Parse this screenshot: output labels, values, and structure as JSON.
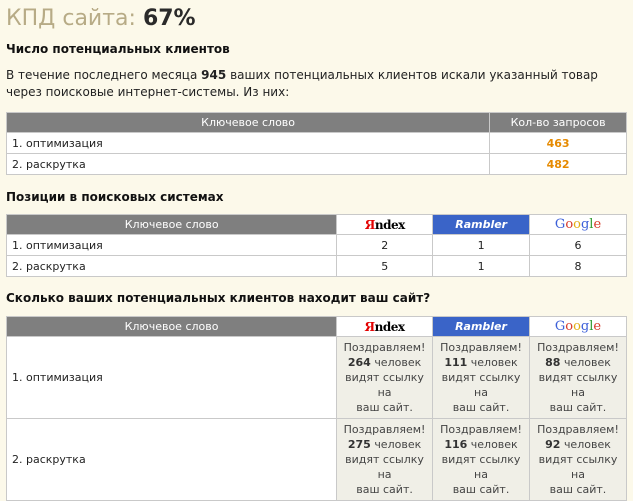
{
  "header": {
    "title_label": "КПД сайта:",
    "title_value": "67%"
  },
  "section1": {
    "heading": "Число потенциальных клиентов",
    "para_before": "В течение последнего месяца",
    "para_count": "945",
    "para_after": "ваших потенциальных клиентов искали указанный товар через поисковые интернет-системы. Из них:",
    "table": {
      "col_keyword": "Ключевое слово",
      "col_requests": "Кол-во запросов",
      "rows": [
        {
          "keyword": "1. оптимизация",
          "requests": "463"
        },
        {
          "keyword": "2. раскрутка",
          "requests": "482"
        }
      ]
    }
  },
  "section2": {
    "heading": "Позиции в поисковых системах",
    "table": {
      "col_keyword": "Ключевое слово",
      "logos": {
        "yandex_first": "Я",
        "yandex_rest": "ndex",
        "rambler": "Rambler",
        "google": [
          "G",
          "o",
          "o",
          "g",
          "l",
          "e"
        ]
      },
      "rows": [
        {
          "keyword": "1. оптимизация",
          "yandex": "2",
          "rambler": "1",
          "google": "6"
        },
        {
          "keyword": "2. раскрутка",
          "yandex": "5",
          "rambler": "1",
          "google": "8"
        }
      ]
    }
  },
  "section3": {
    "heading": "Сколько ваших потенциальных клиентов находит ваш сайт?",
    "table": {
      "col_keyword": "Ключевое слово",
      "congrats": "Поздравляем!",
      "people": "человек",
      "see_link_1": "видят ссылку на",
      "see_link_2": "ваш сайт.",
      "rows": [
        {
          "keyword": "1. оптимизация",
          "yandex": "264",
          "rambler": "111",
          "google": "88"
        },
        {
          "keyword": "2. раскрутка",
          "yandex": "275",
          "rambler": "116",
          "google": "92"
        }
      ]
    }
  },
  "colors": {
    "background": "#fcf9ea",
    "header_gray": "#7f7f7f",
    "accent_orange": "#e68a00",
    "rambler_blue": "#3a64c8"
  }
}
